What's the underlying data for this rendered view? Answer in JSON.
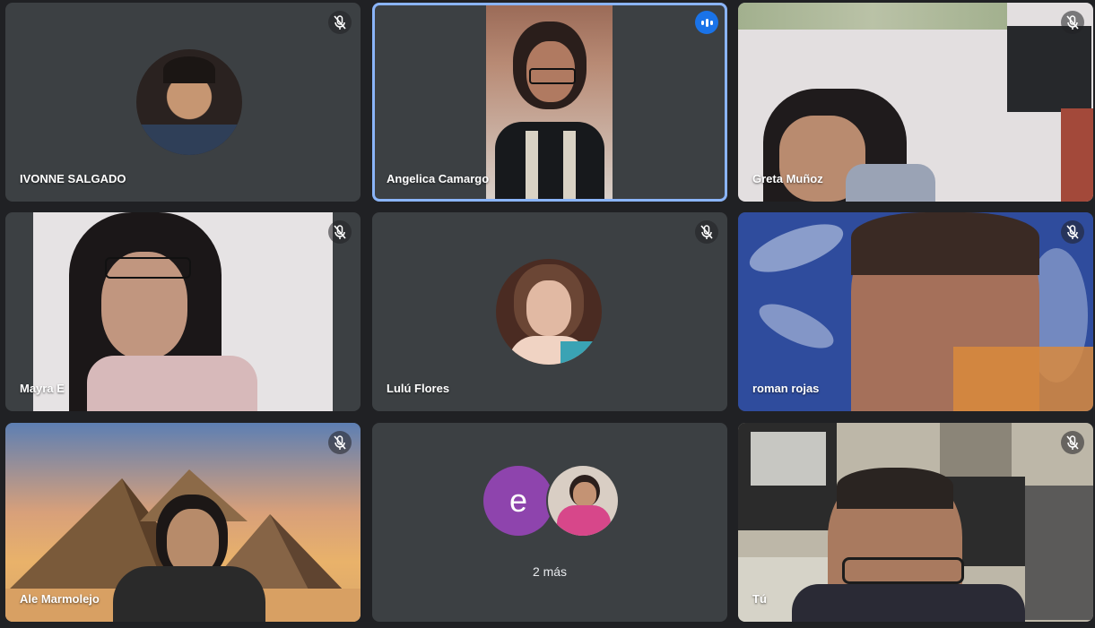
{
  "participants": [
    {
      "name": "IVONNE SALGADO",
      "mic": "muted",
      "view": "avatar"
    },
    {
      "name": "Angelica Camargo",
      "mic": "speaking",
      "view": "video"
    },
    {
      "name": "Greta Muñoz",
      "mic": "muted",
      "view": "video"
    },
    {
      "name": "Mayra E",
      "mic": "muted",
      "view": "video"
    },
    {
      "name": "Lulú Flores",
      "mic": "muted",
      "view": "avatar"
    },
    {
      "name": "roman rojas",
      "mic": "muted",
      "view": "video"
    },
    {
      "name": "Ale Marmolejo",
      "mic": "muted",
      "view": "video"
    },
    {
      "name": "Tú",
      "mic": "muted",
      "view": "video"
    }
  ],
  "overflow": {
    "avatar_letter": "e",
    "label": "2 más"
  },
  "colors": {
    "tile_bg": "#3c4043",
    "page_bg": "#202124",
    "speaking_outline": "#8ab4f8",
    "speaking_badge": "#1a73e8",
    "letter_avatar": "#8e44ad"
  }
}
